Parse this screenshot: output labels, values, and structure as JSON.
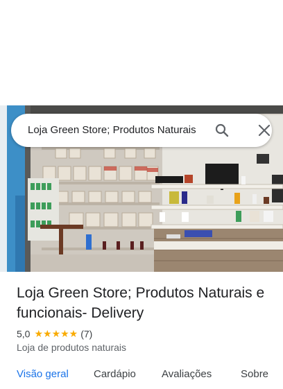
{
  "search": {
    "query": "Loja Green Store; Produtos Naturais",
    "search_icon": "search-icon",
    "clear_icon": "close-icon"
  },
  "place": {
    "name": "Loja Green Store; Produtos Naturais e funcionais- Delivery",
    "rating": "5,0",
    "stars": "★★★★★",
    "review_count": "(7)",
    "category": "Loja de produtos naturais"
  },
  "tabs": [
    {
      "label": "Visão geral",
      "active": true
    },
    {
      "label": "Cardápio",
      "active": false
    },
    {
      "label": "Avaliações",
      "active": false
    },
    {
      "label": "Sobre",
      "active": false
    }
  ],
  "colors": {
    "accent": "#1a73e8",
    "star": "#f9ab00",
    "text": "#202124",
    "secondary": "#5f6368"
  }
}
